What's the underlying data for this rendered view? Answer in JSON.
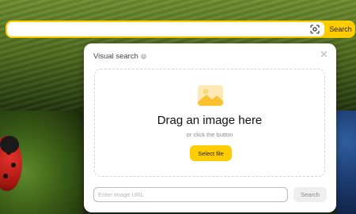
{
  "search_bar": {
    "query": "",
    "search_label": "Search",
    "camera_icon": "camera-lens-icon",
    "accent": "#ffcc00"
  },
  "visual_search": {
    "title": "Visual search",
    "info_icon": "info-icon",
    "close_icon": "close-icon",
    "drop_icon": "image-placeholder-icon",
    "drop_title": "Drag an image here",
    "drop_subtitle": "or click the button",
    "select_file_label": "Select file",
    "url_placeholder": "Enter image URL",
    "url_value": "",
    "url_search_label": "Search"
  }
}
